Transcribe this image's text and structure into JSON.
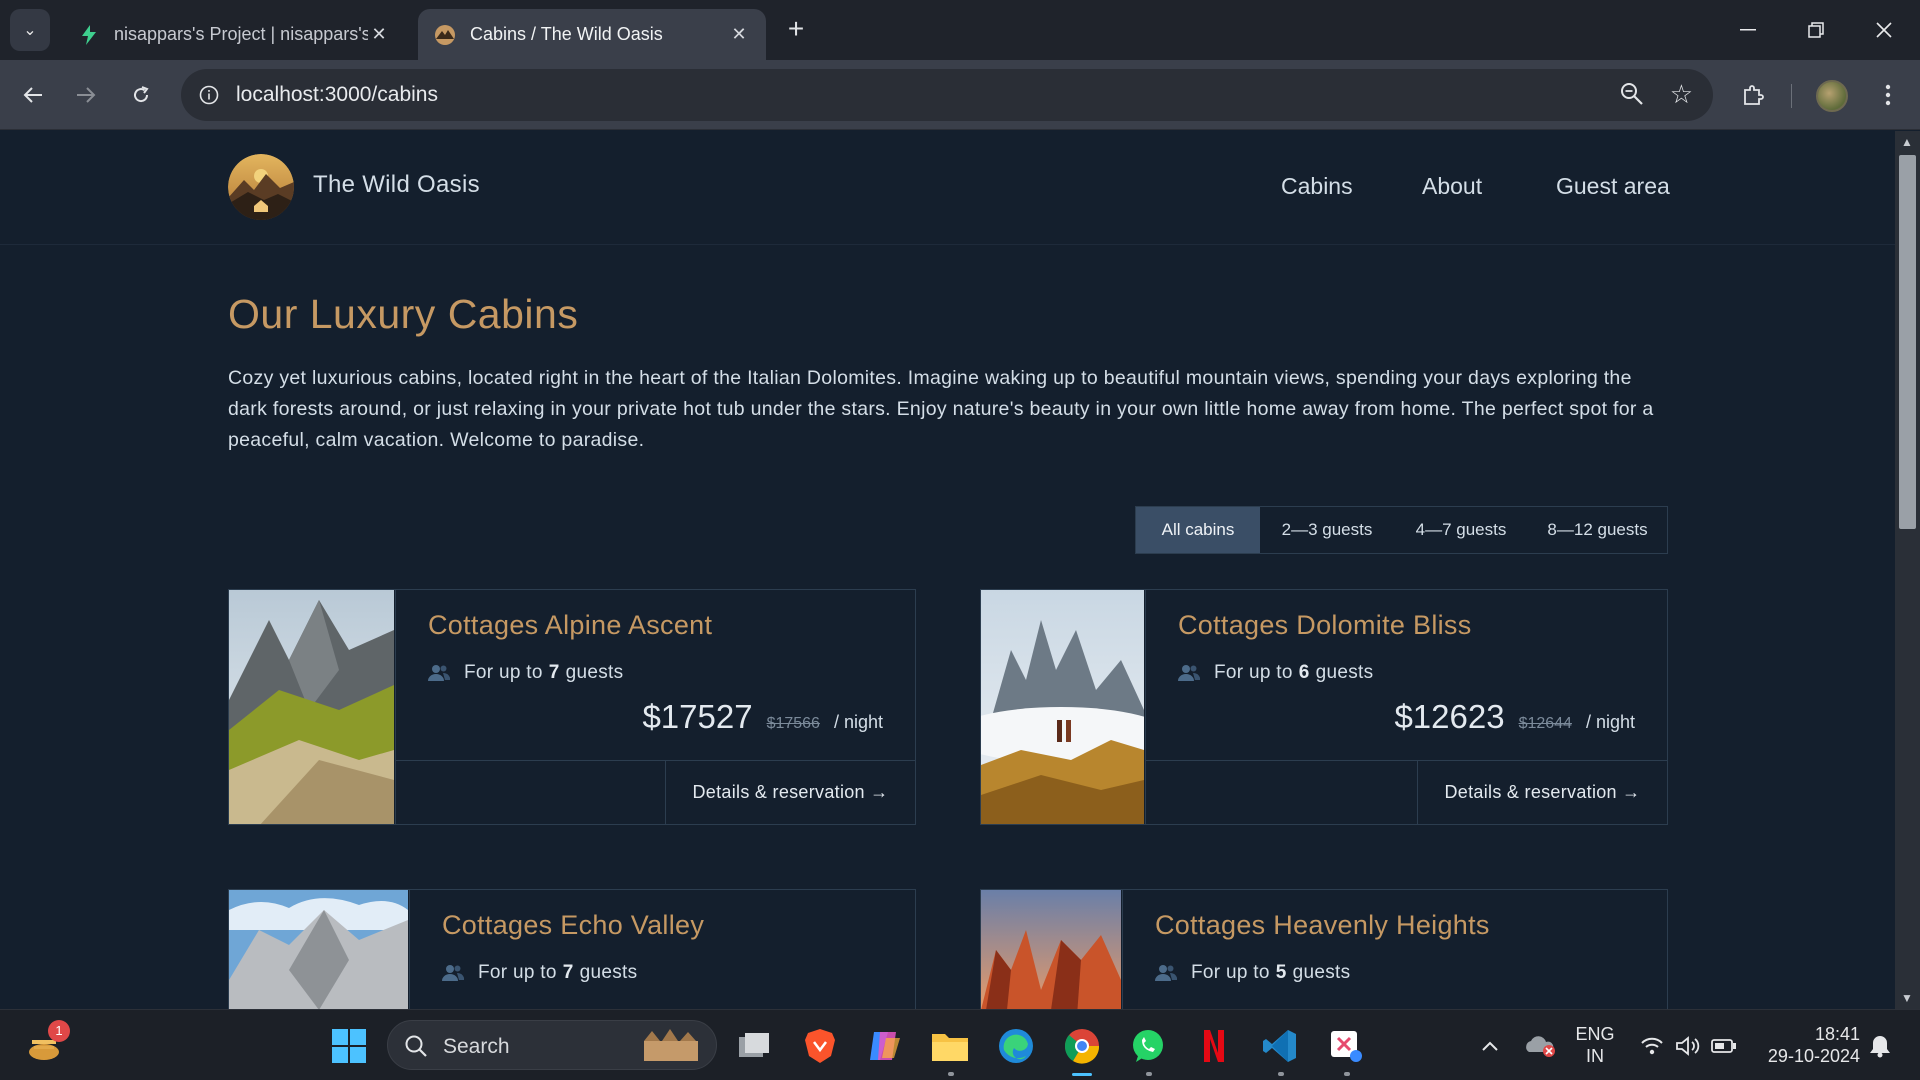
{
  "browser": {
    "tabs": [
      {
        "title": "nisappars's Project | nisappars's",
        "active": false
      },
      {
        "title": "Cabins / The Wild Oasis",
        "active": true
      }
    ],
    "url": "localhost:3000/cabins",
    "close_glyph": "✕",
    "new_tab_glyph": "+"
  },
  "site": {
    "brand": "The Wild Oasis",
    "nav": [
      "Cabins",
      "About",
      "Guest area"
    ]
  },
  "page": {
    "title": "Our Luxury Cabins",
    "intro": "Cozy yet luxurious cabins, located right in the heart of the Italian Dolomites. Imagine waking up to beautiful mountain views, spending your days exploring the dark forests around, or just relaxing in your private hot tub under the stars. Enjoy nature's beauty in your own little home away from home. The perfect spot for a peaceful, calm vacation. Welcome to paradise.",
    "filters": [
      "All cabins",
      "2—3 guests",
      "4—7 guests",
      "8—12 guests"
    ],
    "active_filter": "All cabins"
  },
  "cabins": [
    {
      "name": "Cottages Alpine Ascent",
      "cap_prefix": "For up to",
      "guests": "7",
      "cap_suffix": "guests",
      "price": "$17527",
      "old_price": "$17566",
      "per": "/ night",
      "cta": "Details & reservation →"
    },
    {
      "name": "Cottages Dolomite Bliss",
      "cap_prefix": "For up to",
      "guests": "6",
      "cap_suffix": "guests",
      "price": "$12623",
      "old_price": "$12644",
      "per": "/ night",
      "cta": "Details & reservation →"
    },
    {
      "name": "Cottages Echo Valley",
      "cap_prefix": "For up to",
      "guests": "7",
      "cap_suffix": "guests"
    },
    {
      "name": "Cottages Heavenly Heights",
      "cap_prefix": "For up to",
      "guests": "5",
      "cap_suffix": "guests"
    }
  ],
  "taskbar": {
    "search_label": "Search",
    "weather_badge": "1",
    "language": "ENG",
    "region": "IN",
    "time": "18:41",
    "date": "29-10-2024"
  },
  "colors": {
    "accent": "#c69963",
    "background": "#141f2d",
    "border": "#2c3d4f",
    "filter_active": "#3a4e66"
  }
}
